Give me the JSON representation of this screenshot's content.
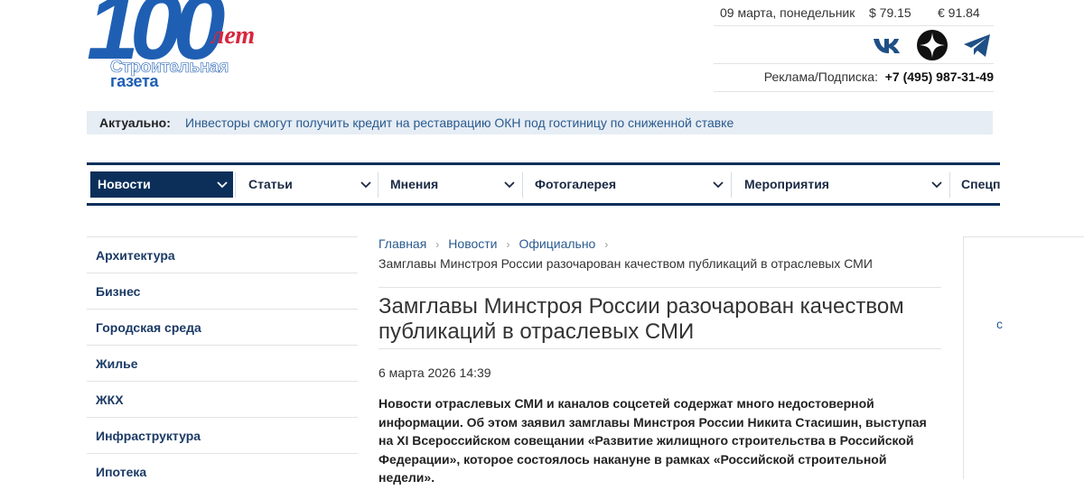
{
  "logo": {
    "numeral": "100",
    "years": "лет",
    "line1": "Строительная",
    "line2": "газета"
  },
  "header": {
    "date": "09 марта, понедельник",
    "usd": "$ 79.15",
    "eur": "€ 91.84",
    "ad_label": "Реклама/Подписка:",
    "ad_phone": "+7 (495) 987-31-49"
  },
  "socials": [
    {
      "name": "vk-icon"
    },
    {
      "name": "dzen-icon"
    },
    {
      "name": "telegram-icon"
    }
  ],
  "actual": {
    "label": "Актуально:",
    "link": "Инвесторы смогут получить кредит на реставрацию ОКН под гостиницу по сниженной ставке"
  },
  "nav": [
    {
      "label": "Новости",
      "active": true
    },
    {
      "label": "Статьи"
    },
    {
      "label": "Мнения"
    },
    {
      "label": "Фотогалерея"
    },
    {
      "label": "Мероприятия"
    },
    {
      "label": "Спецп"
    }
  ],
  "sidebar": [
    "Архитектура",
    "Бизнес",
    "Городская среда",
    "Жилье",
    "ЖКХ",
    "Инфраструктура",
    "Ипотека"
  ],
  "breadcrumbs": [
    "Главная",
    "Новости",
    "Официально"
  ],
  "article": {
    "crumb_current": "Замглавы Минстроя России разочарован качеством публикаций в отраслевых СМИ",
    "title": "Замглавы Минстроя России разочарован качеством публикаций в отраслевых СМИ",
    "date": "6 марта 2026 14:39",
    "lead": "Новости отраслевых СМИ и каналов соцсетей содержат много недостоверной информации. Об этом заявил замглавы Минстроя России Никита Стасишин, выступая на XI Всероссийском совещании «Развитие жилищного строительства в Российской Федерации», которое состоялось накануне в рамках «Российской строительной недели»."
  },
  "rightbox": {
    "char": "с"
  },
  "colors": {
    "brand": "#1f5fb3",
    "nav": "#0c2f5a",
    "accent": "#d7263d",
    "link": "#2a5a8f"
  }
}
